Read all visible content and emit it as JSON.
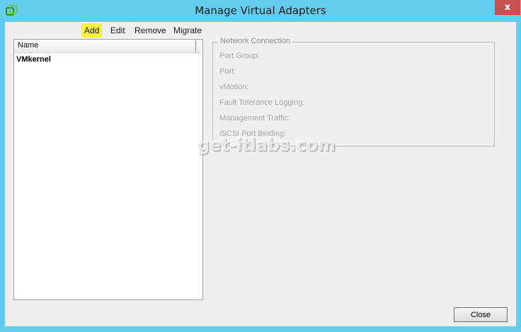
{
  "window": {
    "title": "Manage Virtual Adapters",
    "close_glyph": "x",
    "app_icon": "vsphere-icon"
  },
  "toolbar": {
    "add_label": "Add",
    "edit_label": "Edit",
    "remove_label": "Remove",
    "migrate_label": "Migrate",
    "highlight_color": "#f6f33a"
  },
  "adapter_list": {
    "column_header": "Name",
    "items": [
      {
        "label": "VMkernel"
      }
    ]
  },
  "network_connection": {
    "legend": "Network Connection",
    "fields": [
      {
        "label": "Port Group:"
      },
      {
        "label": "Port:"
      },
      {
        "label": "vMotion:"
      },
      {
        "label": "Fault Tolerance Logging:"
      },
      {
        "label": "Management Traffic:"
      },
      {
        "label": "iSCSI Port Binding:"
      }
    ]
  },
  "watermark": "get-itlabs.com",
  "footer": {
    "close_label": "Close"
  },
  "colors": {
    "title_bar": "#62cdee",
    "close_x": "#c75050"
  }
}
